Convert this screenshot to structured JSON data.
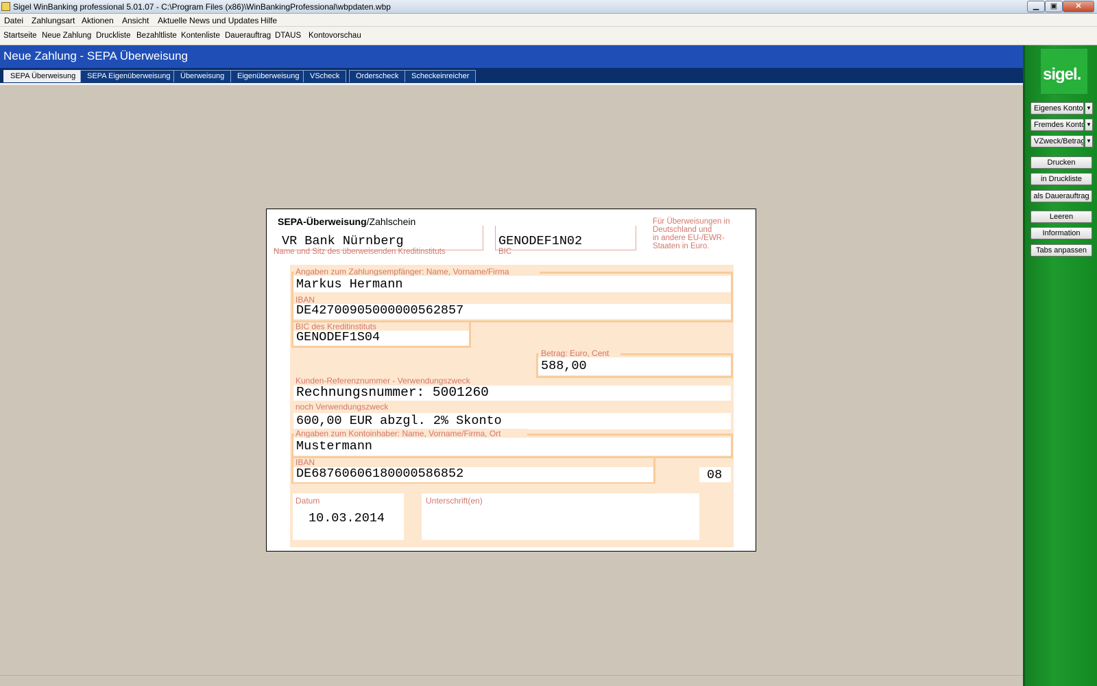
{
  "window": {
    "title": "Sigel WinBanking professional 5.01.07 - C:\\Program Files (x86)\\WinBankingProfessional\\wbpdaten.wbp",
    "minimize": "▁",
    "maximize": "▣",
    "close": "✕"
  },
  "menu": [
    "Datei",
    "Zahlungsart",
    "Aktionen",
    "Ansicht",
    "Aktuelle News und Updates",
    "Hilfe"
  ],
  "toolbar": [
    "Startseite",
    "Neue Zahlung",
    "Druckliste",
    "Bezahltliste",
    "Kontenliste",
    "Dauerauftrag",
    "DTAUS",
    "Kontovorschau"
  ],
  "header": {
    "title": "Neue Zahlung - SEPA Überweisung"
  },
  "tabs": [
    {
      "label": "SEPA Überweisung",
      "active": true
    },
    {
      "label": "SEPA Eigenüberweisung",
      "active": false
    },
    {
      "label": "Überweisung",
      "active": false
    },
    {
      "label": "Eigenüberweisung",
      "active": false
    },
    {
      "label": "VScheck",
      "active": false
    },
    {
      "label": "Orderscheck",
      "active": false
    },
    {
      "label": "Scheckeinreicher",
      "active": false
    }
  ],
  "panel": {
    "logo": "sigel.",
    "dropdowns": [
      "Eigenes Konto",
      "Fremdes Konto",
      "VZweck/Betrag"
    ],
    "dropdown_arrow": "▼",
    "buttons": [
      "Drucken",
      "in Druckliste",
      "als Dauerauftrag",
      "Leeren",
      "Information",
      "Tabs anpassen"
    ]
  },
  "form": {
    "title_bold": "SEPA-Überweisung",
    "title_rest": "/Zahlschein",
    "bank_name": "VR Bank Nürnberg",
    "bank_label": "Name und Sitz des überweisenden Kreditinstituts",
    "bank_bic": "GENODEF1N02",
    "bank_bic_label": "BIC",
    "note": [
      "Für Überweisungen in",
      "Deutschland und",
      "in andere EU-/EWR-",
      "Staaten in Euro."
    ],
    "recipient_label": "Angaben zum Zahlungsempfänger: Name, Vorname/Firma",
    "recipient_name": "Markus Hermann",
    "recipient_iban_label": "IBAN",
    "recipient_iban": "DE42700905000000562857",
    "recipient_bic_label": "BIC des Kreditinstituts",
    "recipient_bic": "GENODEF1S04",
    "amount_label": "Betrag: Euro, Cent",
    "amount": "588,00",
    "reference_label": "Kunden-Referenznummer - Verwendungszweck",
    "reference": "Rechnungsnummer: 5001260",
    "purpose_label": "noch Verwendungszweck",
    "purpose": "600,00 EUR abzgl. 2% Skonto",
    "holder_label": "Angaben zum Kontoinhaber: Name, Vorname/Firma, Ort",
    "holder_name": "Mustermann",
    "holder_iban_label": "IBAN",
    "holder_iban": "DE68760606180000586852",
    "code": "08",
    "date_label": "Datum",
    "date": "10.03.2014",
    "signature_label": "Unterschrift(en)"
  }
}
